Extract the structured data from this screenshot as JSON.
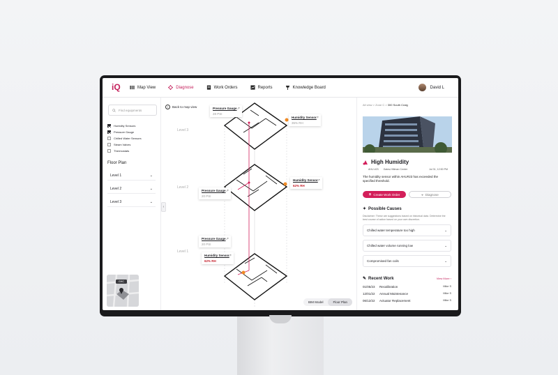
{
  "nav": {
    "logo": "iQ",
    "items": [
      {
        "label": "Map View",
        "icon": "map-icon"
      },
      {
        "label": "Diagnose",
        "icon": "diagnose-icon"
      },
      {
        "label": "Work Orders",
        "icon": "work-orders-icon"
      },
      {
        "label": "Reports",
        "icon": "reports-icon"
      },
      {
        "label": "Knowledge Board",
        "icon": "knowledge-board-icon"
      }
    ],
    "active_index": 1,
    "user_name": "David L"
  },
  "left_panel": {
    "search_placeholder": "Find equipments",
    "filters": [
      {
        "label": "Humidity Sensors",
        "checked": true
      },
      {
        "label": "Pressure Gauge",
        "checked": true
      },
      {
        "label": "Chilled Water Sensors",
        "checked": false
      },
      {
        "label": "Steam Valves",
        "checked": false
      },
      {
        "label": "Thermostats",
        "checked": false
      }
    ],
    "floor_plan_title": "Floor  Plan",
    "levels": [
      "Level 1",
      "Level 2",
      "Level 3"
    ],
    "map_pin_label": "GHC"
  },
  "center": {
    "back_label": "Back to map view",
    "level_labels": [
      "Level 3",
      "Level 2",
      "Level 1"
    ],
    "callouts": [
      {
        "title": "Pressure Gauge",
        "value": "28 PSI"
      },
      {
        "title": "Humidity Sensor",
        "value": "35% RH"
      },
      {
        "title": "Humidity Sensor",
        "value": "62% RH"
      },
      {
        "title": "Pressure Gauge",
        "value": "20 PSI"
      },
      {
        "title": "Pressure Gauge",
        "value": "20 PSI"
      },
      {
        "title": "Humidity Sensor",
        "value": "62% RH"
      }
    ],
    "view_toggle": [
      "BIM Model",
      "Floor Plan"
    ],
    "active_view": "Floor Plan"
  },
  "right_panel": {
    "breadcrumb_prefix": "All view > Zone C > ",
    "breadcrumb_current": "300 South Craig",
    "alert_title": "High Humidity",
    "meta_unit": "AHU #23",
    "meta_location": "Gates-Hillman Center",
    "meta_datetime": "Jul 31, 12:50 PM",
    "description": "The humidity sensor within AHU#23 has exceeded the specified threshold.",
    "primary_button": "Create Work Order",
    "secondary_button": "Diagnose",
    "causes_title": "Possible Causes",
    "disclaimer": "Disclaimer: These are suggestions based on historical data. Determine the best course of action based on your own discretion.",
    "causes": [
      "Chilled water temperature too high",
      "Chilled water volume running low",
      "Compromised fan coils"
    ],
    "recent_title": "Recent Work",
    "view_more": "View More",
    "recent": [
      {
        "date": "01/05/23",
        "work": "Recalibration",
        "user": "Mike S"
      },
      {
        "date": "12/01/22",
        "work": "Annual Maintenance",
        "user": "Mike S"
      },
      {
        "date": "06/12/22",
        "work": "Actuator Replacement",
        "user": "Mike S"
      }
    ]
  },
  "colors": {
    "accent": "#d31f5a",
    "warning_dot": "#f08a24"
  }
}
